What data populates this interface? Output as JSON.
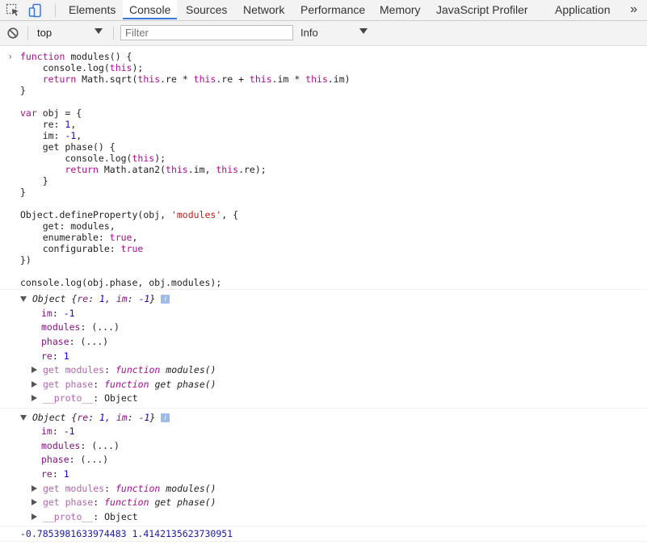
{
  "tabs": {
    "inspect_icon": "cursor-select-icon",
    "device_icon": "device-toolbar-icon",
    "items": [
      "Elements",
      "Console",
      "Sources",
      "Network",
      "Performance",
      "Memory",
      "JavaScript Profiler",
      "Application"
    ],
    "active": "Console",
    "more": "»"
  },
  "toolbar": {
    "clear_icon": "clear-console-icon",
    "context": "top",
    "filter_placeholder": "Filter",
    "level": "Info"
  },
  "console": {
    "prompt": "›",
    "code": {
      "l1a": "function",
      "l1b": " modules() {",
      "l2a": "    console.log(",
      "l2b": "this",
      "l2c": ");",
      "l3a": "    ",
      "l3b": "return",
      "l3c": " Math.sqrt(",
      "l3d": "this",
      "l3e": ".re * ",
      "l3f": "this",
      "l3g": ".re + ",
      "l3h": "this",
      "l3i": ".im * ",
      "l3j": "this",
      "l3k": ".im)",
      "l4": "}",
      "l6a": "var",
      "l6b": " obj = {",
      "l7a": "    re: ",
      "l7b": "1",
      "l7c": ",",
      "l8a": "    im: ",
      "l8b": "-1",
      "l8c": ",",
      "l9a": "    get",
      "l9b": " phase() {",
      "l10a": "        console.log(",
      "l10b": "this",
      "l10c": ");",
      "l11a": "        ",
      "l11b": "return",
      "l11c": " Math.atan2(",
      "l11d": "this",
      "l11e": ".im, ",
      "l11f": "this",
      "l11g": ".re);",
      "l12": "    }",
      "l13": "}",
      "l15a": "Object.defineProperty(obj, ",
      "l15b": "'modules'",
      "l15c": ", {",
      "l16": "    get: modules,",
      "l17a": "    enumerable: ",
      "l17b": "true",
      "l17c": ",",
      "l18a": "    configurable: ",
      "l18b": "true",
      "l19": "})",
      "l21": "console.log(obj.phase, obj.modules);"
    },
    "objects": [
      {
        "summary_a": "Object {",
        "summary_re_k": "re",
        "summary_sep1": ": ",
        "summary_re_v": "1",
        "summary_comma": ", ",
        "summary_im_k": "im",
        "summary_sep2": ": ",
        "summary_im_v": "-1",
        "summary_close": "}",
        "badge": "i",
        "im_k": "im",
        "im_v": "-1",
        "modules_k": "modules",
        "modules_v": "(...)",
        "phase_k": "phase",
        "phase_v": "(...)",
        "re_k": "re",
        "re_v": "1",
        "get_modules_k": "get modules",
        "get_modules_v1": "function",
        "get_modules_v2": "modules()",
        "get_phase_k": "get phase",
        "get_phase_v1": "function",
        "get_phase_v2": "get phase()",
        "proto_k": "__proto__",
        "proto_v": "Object"
      },
      {
        "summary_a": "Object {",
        "summary_re_k": "re",
        "summary_sep1": ": ",
        "summary_re_v": "1",
        "summary_comma": ", ",
        "summary_im_k": "im",
        "summary_sep2": ": ",
        "summary_im_v": "-1",
        "summary_close": "}",
        "badge": "i",
        "im_k": "im",
        "im_v": "-1",
        "modules_k": "modules",
        "modules_v": "(...)",
        "phase_k": "phase",
        "phase_v": "(...)",
        "re_k": "re",
        "re_v": "1",
        "get_modules_k": "get modules",
        "get_modules_v1": "function",
        "get_modules_v2": "modules()",
        "get_phase_k": "get phase",
        "get_phase_v1": "function",
        "get_phase_v2": "get phase()",
        "proto_k": "__proto__",
        "proto_v": "Object"
      }
    ],
    "result": "-0.7853981633974483 1.4142135623730951"
  }
}
